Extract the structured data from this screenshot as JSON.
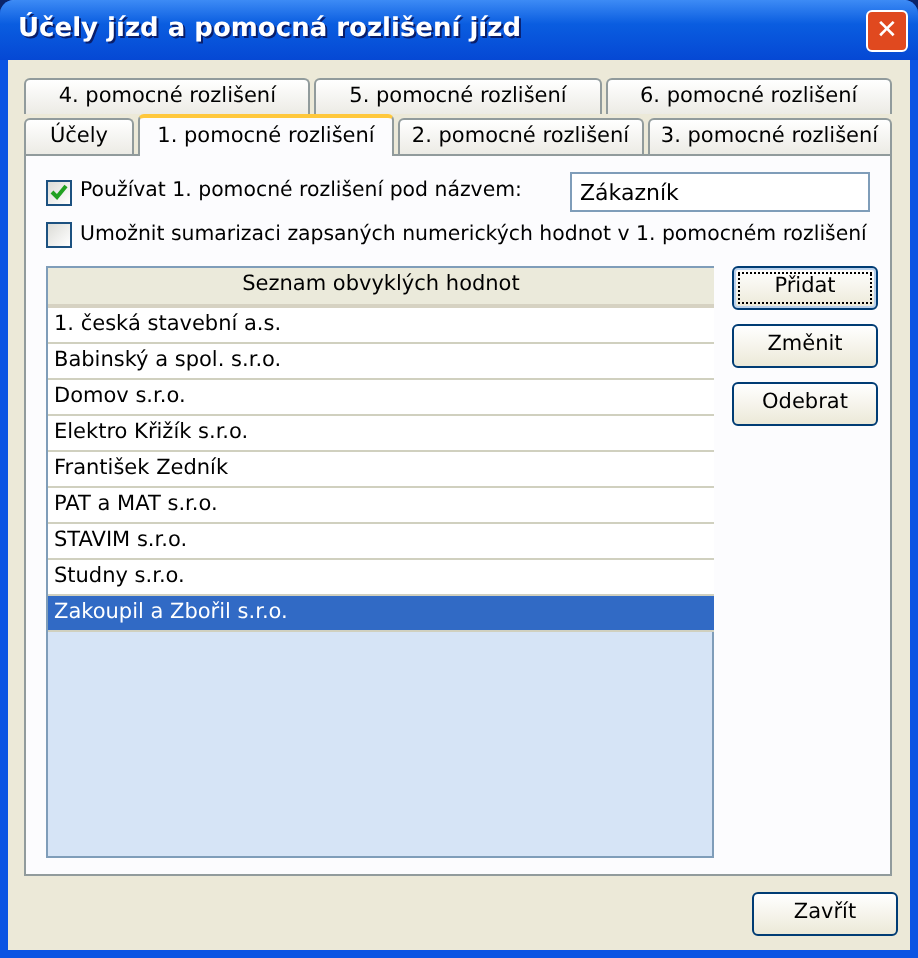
{
  "window": {
    "title": "Účely jízd a pomocná rozlišení jízd",
    "close": "✕"
  },
  "tab_rows": [
    [
      {
        "label": "4. pomocné rozlišení",
        "selected": false
      },
      {
        "label": "5. pomocné rozlišení",
        "selected": false
      },
      {
        "label": "6. pomocné rozlišení",
        "selected": false
      }
    ],
    [
      {
        "label": "Účely",
        "selected": false
      },
      {
        "label": "1. pomocné rozlišení",
        "selected": true
      },
      {
        "label": "2. pomocné rozlišení",
        "selected": false
      },
      {
        "label": "3. pomocné rozlišení",
        "selected": false
      }
    ]
  ],
  "use_name": {
    "label": "Používat 1. pomocné rozlišení pod názvem:",
    "checked": true,
    "value": "Zákazník"
  },
  "allow_sum": {
    "label": "Umožnit sumarizaci zapsaných numerických hodnot v 1. pomocném rozlišení",
    "checked": false
  },
  "list": {
    "header": "Seznam obvyklých hodnot",
    "rows": [
      {
        "text": "1. česká stavební a.s.",
        "selected": false
      },
      {
        "text": "Babinský a spol. s.r.o.",
        "selected": false
      },
      {
        "text": "Domov s.r.o.",
        "selected": false
      },
      {
        "text": "Elektro Křižík s.r.o.",
        "selected": false
      },
      {
        "text": "František Zedník",
        "selected": false
      },
      {
        "text": "PAT a MAT s.r.o.",
        "selected": false
      },
      {
        "text": "STAVIM s.r.o.",
        "selected": false
      },
      {
        "text": "Studny s.r.o.",
        "selected": false
      },
      {
        "text": "Zakoupil a Zbořil s.r.o.",
        "selected": true
      }
    ]
  },
  "side_buttons": [
    {
      "label": "Přidat",
      "focused": true
    },
    {
      "label": "Změnit",
      "focused": false
    },
    {
      "label": "Odebrat",
      "focused": false
    }
  ],
  "close_button": "Zavřít"
}
